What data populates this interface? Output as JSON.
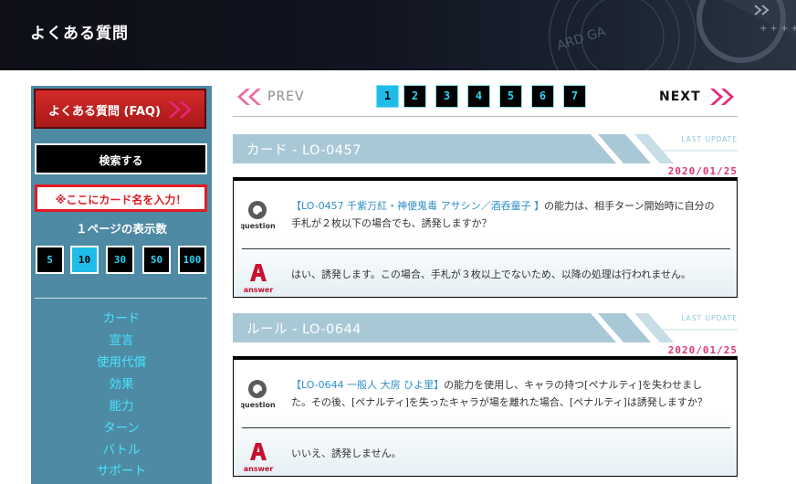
{
  "header": {
    "title": "よくある質問"
  },
  "sidebar": {
    "faq_button": "よくある質問 (FAQ)",
    "search_button": "検索する",
    "card_input_placeholder": "※ここにカード名を入力！",
    "per_page_label": "１ページの表示数",
    "per_page_options": [
      "5",
      "10",
      "30",
      "50",
      "100"
    ],
    "per_page_selected": "10",
    "categories": [
      "カード",
      "宣言",
      "使用代償",
      "効果",
      "能力",
      "ターン",
      "バトル",
      "サポート"
    ]
  },
  "pager": {
    "prev_label": "PREV",
    "next_label": "NEXT",
    "pages": [
      "1",
      "2",
      "3",
      "4",
      "5",
      "6",
      "7"
    ],
    "current_page": "1"
  },
  "entries": [
    {
      "title": "カード - LO-0457",
      "last_update_label": "LAST UPDATE",
      "date": "2020/01/25",
      "question_link": "【LO-0457 千紫万紅・神便鬼毒 アサシン／酒呑童子 】",
      "question_rest_1": "の能力は、相手ターン開始時に自分の",
      "question_rest_2": "手札が２枚以下の場合でも、誘発しますか？",
      "answer": "はい、誘発します。この場合、手札が３枚以上でないため、以降の処理は行われません。"
    },
    {
      "title": "ルール - LO-0644",
      "last_update_label": "LAST UPDATE",
      "date": "2020/01/25",
      "question_link": "【LO-0644 一般人 大房 ひよ里】",
      "question_rest_1": "の能力を使用し、キャラの持つ[ペナルティ]を失わせまし",
      "question_rest_2": "た。その後、[ペナルティ]を失ったキャラが場を離れた場合、[ペナルティ]は誘発しますか？",
      "answer": "いいえ、誘発しません。"
    }
  ],
  "labels": {
    "question_icon": "question",
    "answer_icon": "answer"
  },
  "colors": {
    "accent_pink": "#e8247a",
    "accent_cyan": "#1fbce8",
    "sidebar_bg": "#4e8aa3",
    "banner": "#a9c8d6"
  }
}
